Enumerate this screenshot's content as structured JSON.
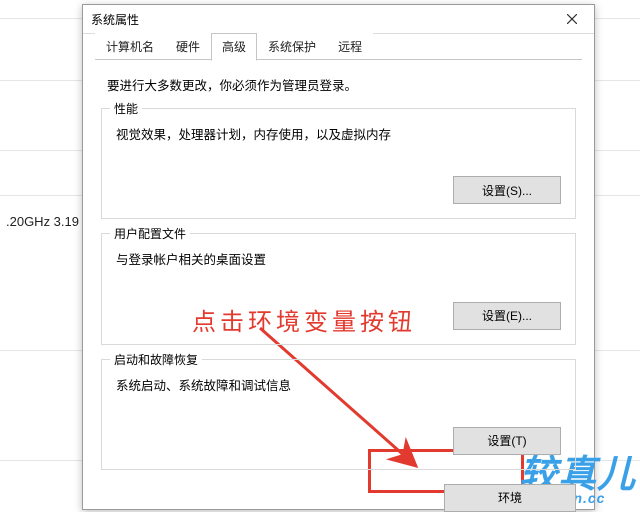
{
  "window": {
    "title": "系统属性",
    "close_label": "关闭"
  },
  "tabs": {
    "items": [
      {
        "label": "计算机名"
      },
      {
        "label": "硬件"
      },
      {
        "label": "高级"
      },
      {
        "label": "系统保护"
      },
      {
        "label": "远程"
      }
    ],
    "active_index": 2
  },
  "intro": "要进行大多数更改，你必须作为管理员登录。",
  "groups": {
    "performance": {
      "legend": "性能",
      "desc": "视觉效果，处理器计划，内存使用，以及虚拟内存",
      "button": "设置(S)..."
    },
    "userprofile": {
      "legend": "用户配置文件",
      "desc": "与登录帐户相关的桌面设置",
      "button": "设置(E)..."
    },
    "startup": {
      "legend": "启动和故障恢复",
      "desc": "系统启动、系统故障和调试信息",
      "button": "设置(T)"
    }
  },
  "env_button": "环境",
  "annotation_text": "点击环境变量按钮",
  "background": {
    "cpu_text": ".20GHz   3.19"
  },
  "watermark": {
    "line1": "较真儿",
    "line2": "jiaozhen.cc"
  }
}
